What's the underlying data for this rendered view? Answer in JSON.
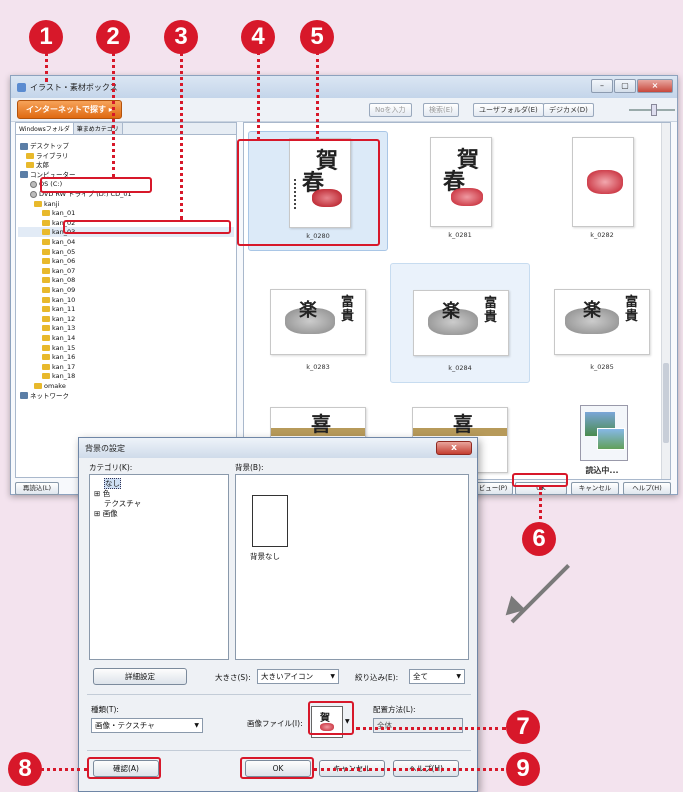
{
  "markers": [
    "1",
    "2",
    "3",
    "4",
    "5",
    "6",
    "7",
    "8",
    "9"
  ],
  "main_window": {
    "title": "イラスト・素材ボックス",
    "internet_button": "インターネットで探す ▸",
    "toolbar": {
      "no_input": "Noを入力",
      "search": "検索(E)",
      "user_folder": "ユーザフォルダ(E)",
      "digicam": "デジカメ(D)"
    },
    "tabs": [
      "Windowsフォルダ",
      "筆まめカテゴリ"
    ],
    "tree": [
      {
        "label": "デスクトップ",
        "icon": "pc"
      },
      {
        "label": "ライブラリ",
        "icon": "folder"
      },
      {
        "label": "太郎",
        "icon": "folder"
      },
      {
        "label": "コンピューター",
        "icon": "pc"
      },
      {
        "label": "OS (C:)",
        "icon": "disc"
      },
      {
        "label": "DVD RW ドライブ (D:) CD_01",
        "icon": "disc"
      },
      {
        "label": "kanji",
        "icon": "folder"
      },
      {
        "label": "kan_01",
        "icon": "folder"
      },
      {
        "label": "kan_02",
        "icon": "folder"
      },
      {
        "label": "kan_03",
        "icon": "folder"
      },
      {
        "label": "kan_04",
        "icon": "folder"
      },
      {
        "label": "kan_05",
        "icon": "folder"
      },
      {
        "label": "kan_06",
        "icon": "folder"
      },
      {
        "label": "kan_07",
        "icon": "folder"
      },
      {
        "label": "kan_08",
        "icon": "folder"
      },
      {
        "label": "kan_09",
        "icon": "folder"
      },
      {
        "label": "kan_10",
        "icon": "folder"
      },
      {
        "label": "kan_11",
        "icon": "folder"
      },
      {
        "label": "kan_12",
        "icon": "folder"
      },
      {
        "label": "kan_13",
        "icon": "folder"
      },
      {
        "label": "kan_14",
        "icon": "folder"
      },
      {
        "label": "kan_15",
        "icon": "folder"
      },
      {
        "label": "kan_16",
        "icon": "folder"
      },
      {
        "label": "kan_17",
        "icon": "folder"
      },
      {
        "label": "kan_18",
        "icon": "folder"
      },
      {
        "label": "omake",
        "icon": "folder"
      },
      {
        "label": "ネットワーク",
        "icon": "pc"
      }
    ],
    "images": [
      {
        "caption": "k_0280",
        "kanji": "賀春"
      },
      {
        "caption": "k_0281",
        "kanji": "賀春"
      },
      {
        "caption": "k_0282",
        "kanji": ""
      },
      {
        "caption": "k_0283",
        "kanji": "富貴"
      },
      {
        "caption": "k_0284",
        "kanji": "富貴"
      },
      {
        "caption": "k_0285",
        "kanji": "富貴"
      },
      {
        "caption": "",
        "kanji": "喜"
      },
      {
        "caption": "",
        "kanji": "喜"
      },
      {
        "caption": "読込中...",
        "kanji": ""
      }
    ],
    "bottom": {
      "reload": "再読込(L)",
      "preview": "ビュー(P)",
      "ok": "OK",
      "cancel": "キャンセル",
      "help": "ヘルプ(H)"
    }
  },
  "dialog": {
    "title": "背景の設定",
    "close": "x",
    "category_label": "カテゴリ(K):",
    "categories": [
      "なし",
      "色",
      "テクスチャ",
      "画像"
    ],
    "background_label": "背景(B):",
    "bg_item_caption": "背景なし",
    "detail_button": "詳細設定",
    "size_label": "大きさ(S):",
    "size_value": "大きいアイコン",
    "filter_label": "絞り込み(E):",
    "filter_value": "全て",
    "type_label": "種類(T):",
    "type_value": "画像・テクスチャ",
    "image_file_label": "画像ファイル(I):",
    "layout_label": "配置方法(L):",
    "layout_value": "全体",
    "confirm_button": "確認(A)",
    "ok_button": "OK",
    "cancel_button": "キャンセル",
    "help_button": "ヘルプ(H)"
  },
  "colors": {
    "marker": "#d7182a",
    "background": "#f3e3ee",
    "accent_orange": "#e06a12"
  }
}
